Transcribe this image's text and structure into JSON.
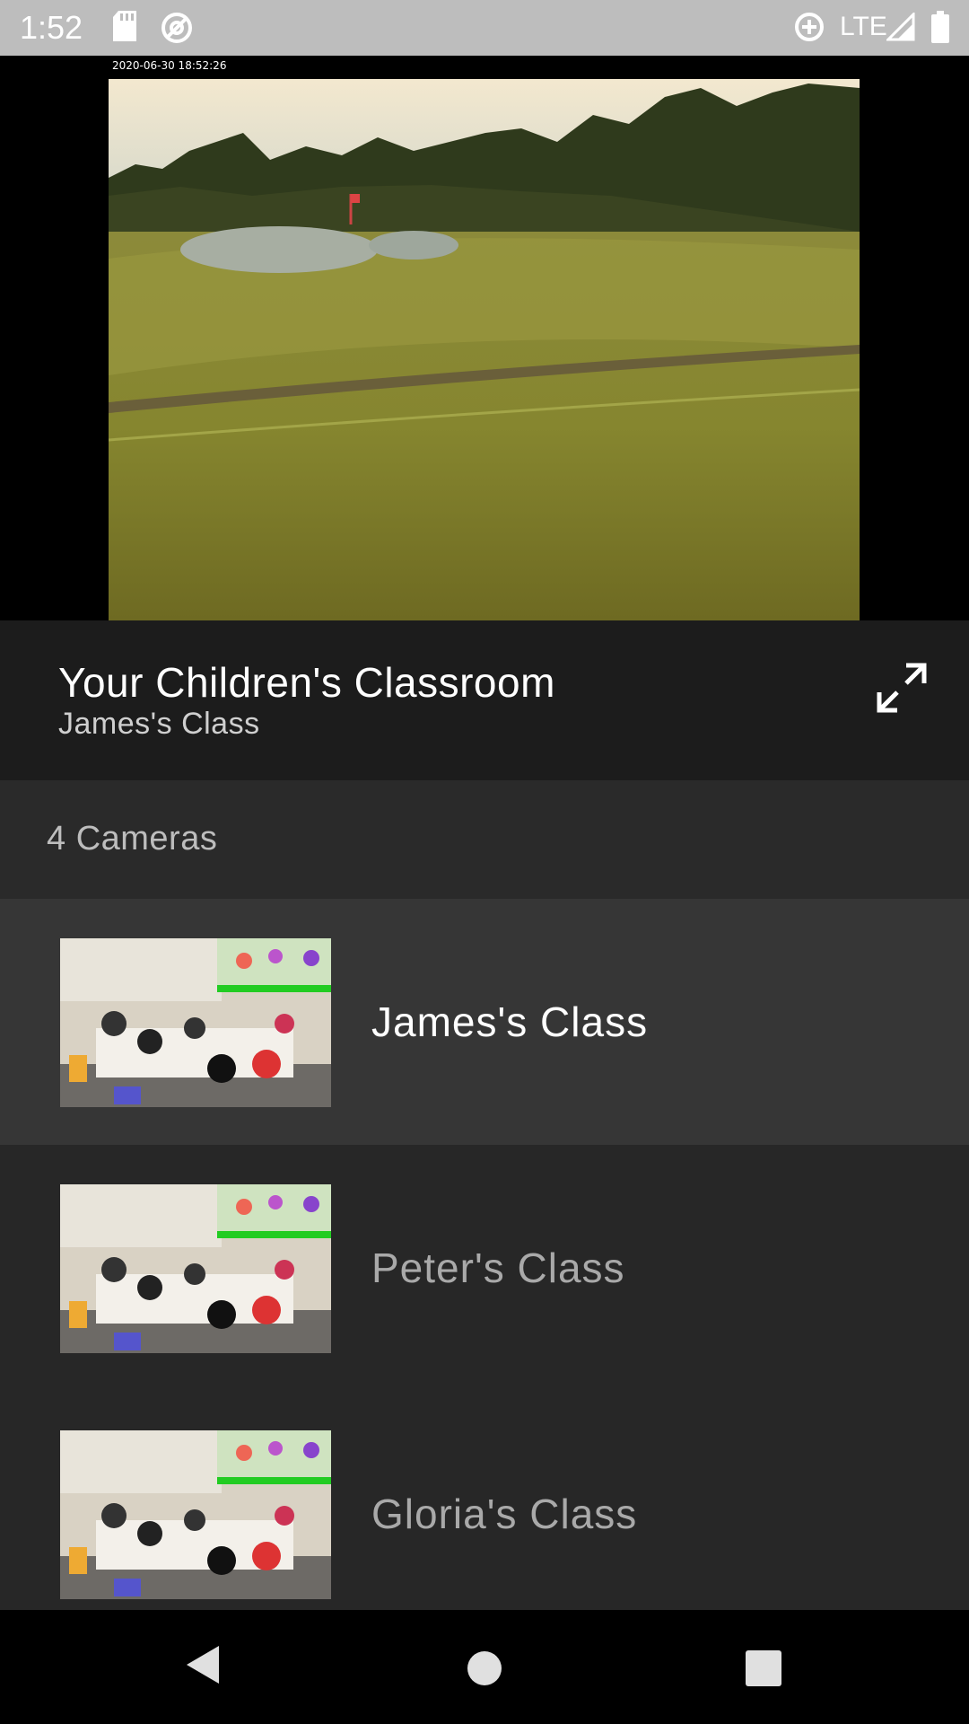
{
  "status_bar": {
    "time": "1:52",
    "network": "LTE",
    "icons": [
      "sd-card-icon",
      "sync-icon",
      "data-saver-icon",
      "signal-icon",
      "battery-icon"
    ]
  },
  "video": {
    "timestamp": "2020-06-30 18:52:26"
  },
  "header": {
    "title": "Your Children's Classroom",
    "subtitle": "James's Class",
    "fullscreen_icon": "fullscreen-icon"
  },
  "cameras": {
    "count_label": "4 Cameras",
    "items": [
      {
        "name": "James's Class",
        "selected": true
      },
      {
        "name": "Peter's Class",
        "selected": false
      },
      {
        "name": "Gloria's Class",
        "selected": false
      }
    ]
  },
  "nav_bar": {
    "icons": [
      "back-icon",
      "home-icon",
      "recents-icon"
    ]
  },
  "colors": {
    "status_bar": "#bdbdbd",
    "header_bg": "#1c1c1c",
    "count_bg": "#2a2a2a",
    "list_bg": "#272727",
    "selected_bg": "#363636"
  }
}
